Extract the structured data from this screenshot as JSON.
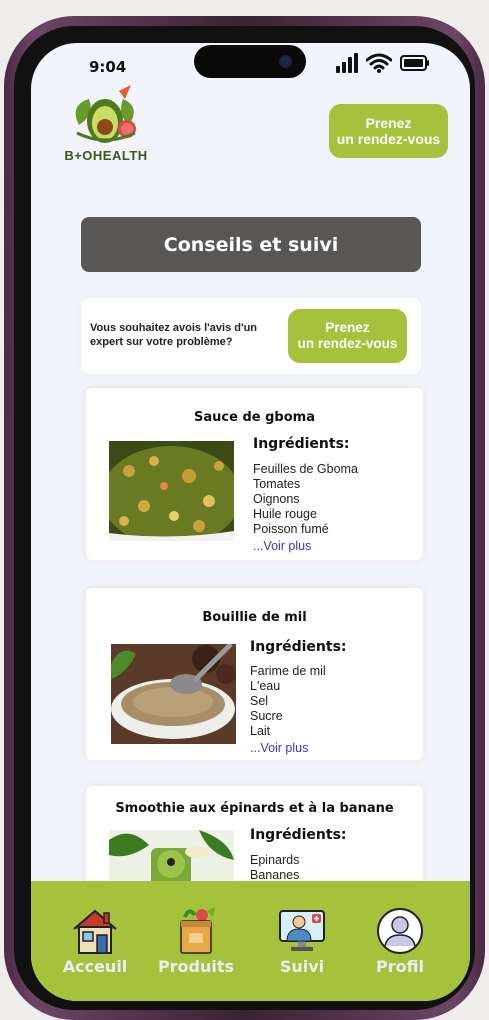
{
  "status_bar": {
    "time": "9:04"
  },
  "logo": {
    "text": "B+OHEALTH"
  },
  "header": {
    "appointment_button": {
      "line1": "Prenez",
      "line2": "un rendez-vous"
    }
  },
  "section": {
    "title": "Conseils et suivi"
  },
  "advice": {
    "text": "Vous souhaitez avois l'avis d'un expert sur votre problème?",
    "button": {
      "line1": "Prenez",
      "line2": "un rendez-vous"
    }
  },
  "recipes": [
    {
      "title": "Sauce de gboma",
      "ingredients_label": "Ingrédients:",
      "ingredients": [
        "Feuilles de Gboma",
        "Tomates",
        "Oignons",
        "Huile rouge",
        "Poisson fumé"
      ],
      "see_more": "...Voir plus"
    },
    {
      "title": "Bouillie de mil",
      "ingredients_label": "Ingrédients:",
      "ingredients": [
        "Farime de mil",
        "L'eau",
        "Sel",
        "Sucre",
        "Lait"
      ],
      "see_more": "...Voir plus"
    },
    {
      "title": "Smoothie aux épinards et à la banane",
      "ingredients_label": "Ingrédients:",
      "ingredients": [
        "Epinards",
        "Bananes"
      ],
      "see_more": ""
    }
  ],
  "nav": [
    {
      "label": "Acceuil",
      "icon": "house-icon"
    },
    {
      "label": "Produits",
      "icon": "grocery-bag-icon"
    },
    {
      "label": "Suivi",
      "icon": "doctor-screen-icon"
    },
    {
      "label": "Profil",
      "icon": "user-icon"
    }
  ],
  "colors": {
    "accent": "#a4c23c",
    "title_bg": "#595656",
    "screen_bg": "#f2f4fb",
    "link": "#3a34c8"
  }
}
